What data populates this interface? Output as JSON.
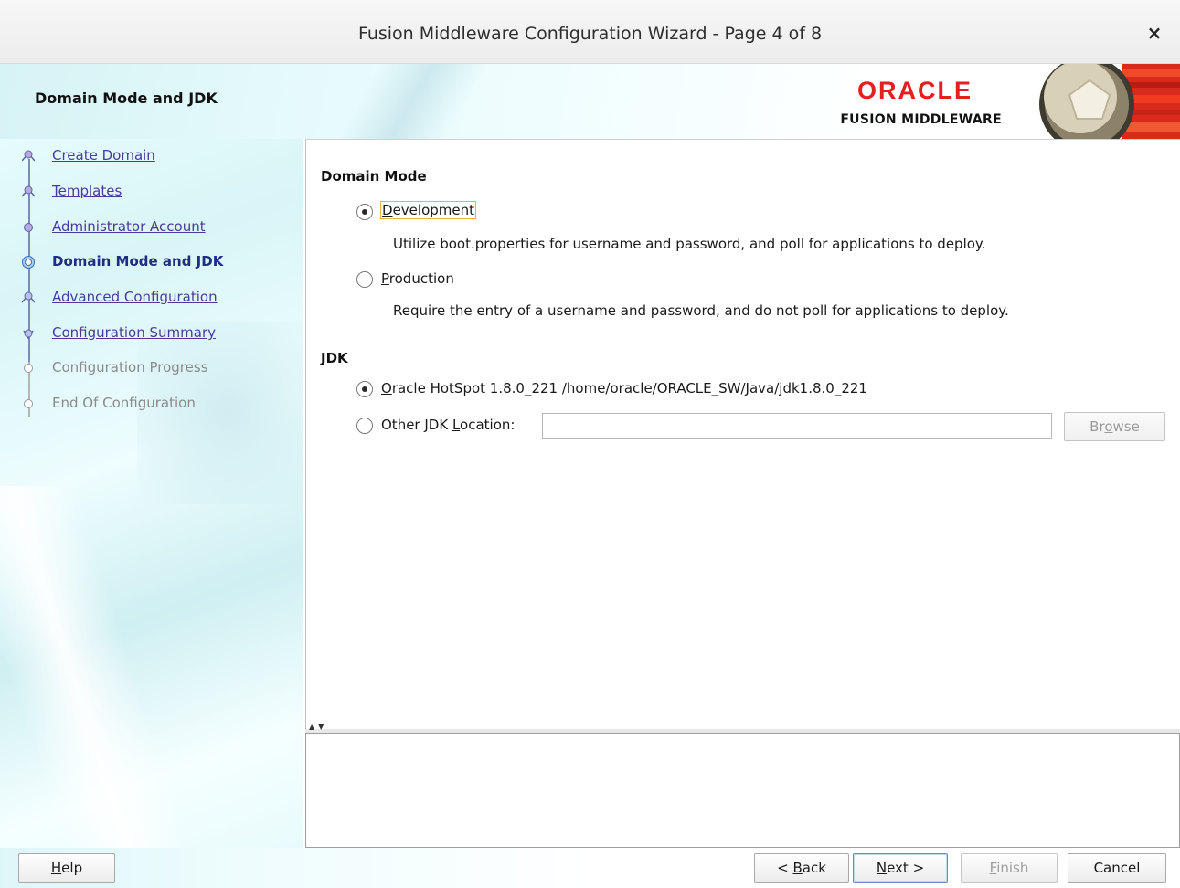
{
  "window": {
    "title": "Fusion Middleware Configuration Wizard - Page 4 of 8",
    "close_glyph": "×"
  },
  "header": {
    "page_heading": "Domain Mode and JDK",
    "logo_brand": "ORACLE",
    "logo_subtitle": "FUSION MIDDLEWARE",
    "brand_color": "#e41f1f"
  },
  "steps": [
    {
      "label": "Create Domain",
      "state": "done"
    },
    {
      "label": "Templates",
      "state": "done"
    },
    {
      "label": "Administrator Account",
      "state": "done"
    },
    {
      "label": "Domain Mode and JDK",
      "state": "current"
    },
    {
      "label": "Advanced Configuration",
      "state": "done"
    },
    {
      "label": "Configuration Summary",
      "state": "done"
    },
    {
      "label": "Configuration Progress",
      "state": "future"
    },
    {
      "label": "End Of Configuration",
      "state": "future"
    }
  ],
  "domain_mode": {
    "section_title": "Domain Mode",
    "development": {
      "mnemonic": "D",
      "rest": "evelopment",
      "checked": true,
      "description": "Utilize boot.properties for username and password, and poll for applications to deploy."
    },
    "production": {
      "mnemonic": "P",
      "rest": "roduction",
      "checked": false,
      "description": "Require the entry of a username and password, and do not poll for applications to deploy."
    }
  },
  "jdk": {
    "section_title": "JDK",
    "oracle_hotspot": {
      "mnemonic": "O",
      "rest": "racle HotSpot 1.8.0_221 /home/oracle/ORACLE_SW/Java/jdk1.8.0_221",
      "checked": true
    },
    "other": {
      "pre": "Other JDK ",
      "mnemonic": "L",
      "rest": "ocation:",
      "checked": false,
      "value": ""
    },
    "browse": {
      "pre": "Br",
      "mnemonic": "o",
      "rest": "wse"
    }
  },
  "buttons": {
    "help": {
      "mnemonic": "H",
      "rest": "elp"
    },
    "back": {
      "pre": "< ",
      "mnemonic": "B",
      "rest": "ack"
    },
    "next": {
      "mnemonic": "N",
      "rest": "ext >"
    },
    "finish": {
      "mnemonic": "F",
      "rest": "inish"
    },
    "cancel": {
      "label": "Cancel"
    }
  }
}
